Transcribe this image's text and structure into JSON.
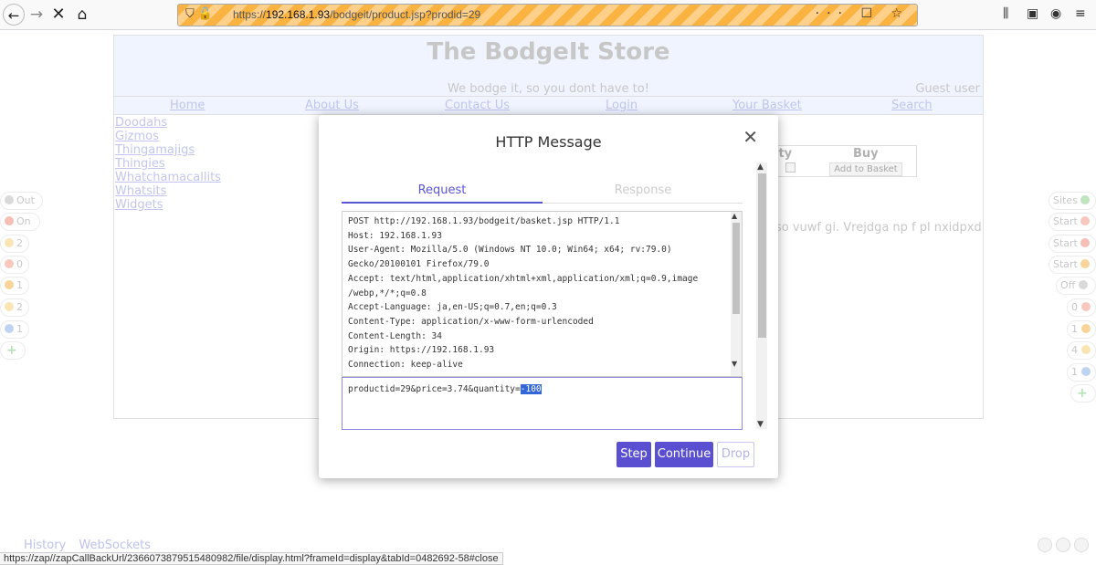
{
  "browser": {
    "url_prefix": "https://",
    "url_host": "192.168.1.93",
    "url_path": "/bodgeit/product.jsp?prodid=29"
  },
  "site": {
    "title": "The BodgeIt Store",
    "tagline": "We bodge it, so you dont have to!",
    "user": "Guest user",
    "nav": [
      "Home",
      "About Us",
      "Contact Us",
      "Login",
      "Your Basket",
      "Search"
    ],
    "categories": [
      "Doodahs",
      "Gizmos",
      "Thingamajigs",
      "Thingies",
      "Whatchamacallits",
      "Whatsits",
      "Widgets"
    ],
    "quantity_header": "ity",
    "buy_header": "Buy",
    "add_to_basket": "Add to Basket",
    "description_fragment": "so vuwf gi. Vrejdga np f pl nxidpxd"
  },
  "hud_left": [
    {
      "label": "Out",
      "color": "#bbb"
    },
    {
      "label": "On",
      "color": "#f08a7a"
    },
    {
      "label": "2",
      "color": "#f5d17a"
    },
    {
      "label": "0",
      "color": "#f39c8b"
    },
    {
      "label": "1",
      "color": "#f5b24a"
    },
    {
      "label": "2",
      "color": "#f5d17a"
    },
    {
      "label": "1",
      "color": "#8fb2e8"
    },
    {
      "label": "+",
      "color": "#7cc77c"
    }
  ],
  "hud_right": [
    {
      "label": "Sites",
      "color": "#8bd18b"
    },
    {
      "label": "Start",
      "color": "#f39c8b"
    },
    {
      "label": "Start",
      "color": "#f08a7a"
    },
    {
      "label": "Start",
      "color": "#f5b24a"
    },
    {
      "label": "Off",
      "color": "#bbb"
    },
    {
      "label": "0",
      "color": "#f39c8b"
    },
    {
      "label": "1",
      "color": "#f5b24a"
    },
    {
      "label": "4",
      "color": "#f5d17a"
    },
    {
      "label": "1",
      "color": "#8fb2e8"
    },
    {
      "label": "+",
      "color": "#7cc77c"
    }
  ],
  "bottom_tabs": [
    "History",
    "WebSockets"
  ],
  "status_url": "https://zap//zapCallBackUrl/2366073879515480982/file/display.html?frameId=display&tabId=0482692-58#close",
  "modal": {
    "title": "HTTP Message",
    "tab_request": "Request",
    "tab_response": "Response",
    "headers": [
      "POST http://192.168.1.93/bodgeit/basket.jsp HTTP/1.1",
      "Host: 192.168.1.93",
      "User-Agent: Mozilla/5.0 (Windows NT 10.0; Win64; x64; rv:79.0)",
      "Gecko/20100101 Firefox/79.0",
      "Accept: text/html,application/xhtml+xml,application/xml;q=0.9,image",
      "/webp,*/*;q=0.8",
      "Accept-Language: ja,en-US;q=0.7,en;q=0.3",
      "Content-Type: application/x-www-form-urlencoded",
      "Content-Length: 34",
      "Origin: https://192.168.1.93",
      "Connection: keep-alive"
    ],
    "body_prefix": "productid=29&price=3.74&quantity=",
    "body_selected": "-100",
    "step_label": "Step",
    "continue_label": "Continue",
    "drop_label": "Drop"
  }
}
